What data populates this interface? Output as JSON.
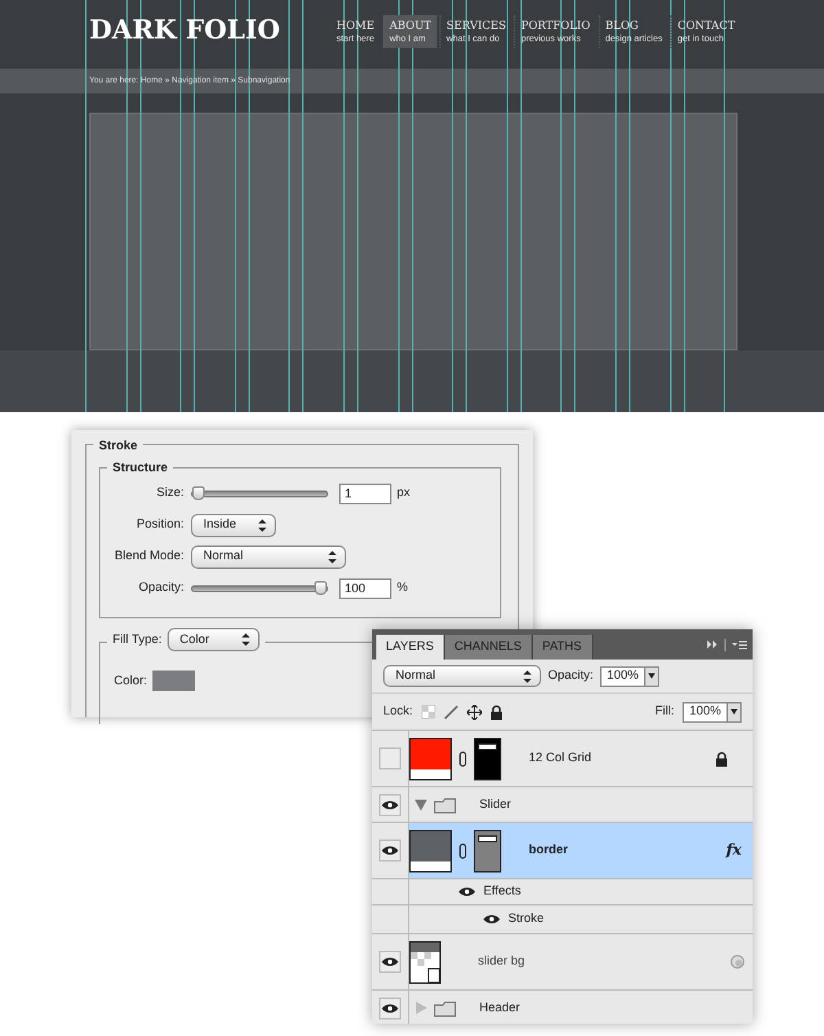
{
  "website": {
    "logo": "DARK FOLIO",
    "nav": [
      {
        "label": "HOME",
        "sublabel": "start here",
        "selected": false
      },
      {
        "label": "ABOUT",
        "sublabel": "who I am",
        "selected": true
      },
      {
        "label": "SERVICES",
        "sublabel": "what I can do",
        "selected": false
      },
      {
        "label": "PORTFOLIO",
        "sublabel": "previous works",
        "selected": false
      },
      {
        "label": "BLOG",
        "sublabel": "design articles",
        "selected": false
      },
      {
        "label": "CONTACT",
        "sublabel": "get in touch",
        "selected": false
      }
    ],
    "breadcrumb": "You are here: Home » Navigation item » Subnavigation"
  },
  "stroke_dialog": {
    "title": "Stroke",
    "structure": {
      "title": "Structure",
      "size": {
        "label": "Size:",
        "value": "1",
        "unit": "px",
        "level": 0
      },
      "position": {
        "label": "Position:",
        "value": "Inside"
      },
      "blend_mode": {
        "label": "Blend Mode:",
        "value": "Normal"
      },
      "opacity": {
        "label": "Opacity:",
        "value": "100",
        "unit": "%",
        "level": 1
      }
    },
    "fill_type": {
      "label": "Fill Type:",
      "value": "Color"
    },
    "color": {
      "label": "Color:",
      "color": "#7b7d80"
    }
  },
  "layers_panel": {
    "tabs": [
      {
        "label": "LAYERS",
        "selected": true
      },
      {
        "label": "CHANNELS",
        "selected": false
      },
      {
        "label": "PATHS",
        "selected": false
      }
    ],
    "blend_mode": "Normal",
    "opacity_label": "Opacity:",
    "opacity": "100%",
    "lock_label": "Lock:",
    "fill_label": "Fill:",
    "fill": "100%",
    "layers": [
      {
        "kind": "layer",
        "name": "12 Col Grid",
        "visible": false,
        "selected": false,
        "color": "#ff1a00",
        "mask": {
          "color": "#000000"
        },
        "locked": true
      },
      {
        "kind": "group",
        "name": "Slider",
        "visible": true,
        "expanded": true,
        "children": [
          {
            "kind": "layer",
            "name": "border",
            "visible": true,
            "selected": true,
            "color": "#5d6064",
            "mask": {
              "color": "#808080"
            },
            "fx": "fx",
            "children": [
              {
                "kind": "effects",
                "name": "Effects",
                "visible": true,
                "children": [
                  {
                    "kind": "effect",
                    "name": "Stroke",
                    "visible": true
                  }
                ]
              }
            ]
          },
          {
            "kind": "smart",
            "name": "slider bg",
            "visible": true,
            "selected": false
          }
        ]
      },
      {
        "kind": "group",
        "name": "Header",
        "visible": true,
        "expanded": false
      }
    ]
  }
}
